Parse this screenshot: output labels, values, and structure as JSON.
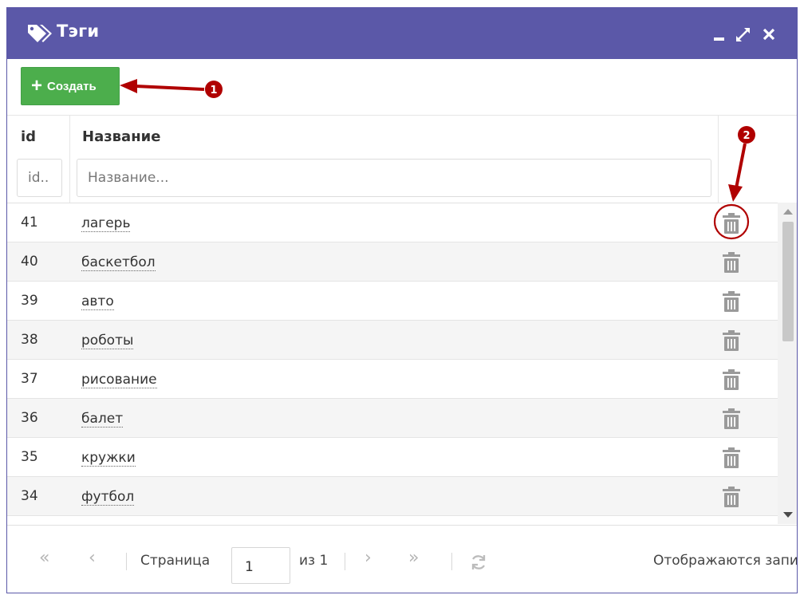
{
  "window": {
    "title": "Тэги",
    "title_icon": "tags-icon",
    "controls": [
      "minimize-icon",
      "maximize-icon",
      "close-icon"
    ],
    "header_color": "#5b58a8"
  },
  "toolbar": {
    "create_label": "Создать",
    "create_color": "#4cae4c"
  },
  "grid": {
    "columns": {
      "id": "id",
      "name": "Название"
    },
    "filters": {
      "id_placeholder": "id..",
      "name_placeholder": "Название..."
    },
    "rows": [
      {
        "id": "41",
        "name": "лагерь"
      },
      {
        "id": "40",
        "name": "баскетбол"
      },
      {
        "id": "39",
        "name": "авто"
      },
      {
        "id": "38",
        "name": "роботы"
      },
      {
        "id": "37",
        "name": "рисование"
      },
      {
        "id": "36",
        "name": "балет"
      },
      {
        "id": "35",
        "name": "кружки"
      },
      {
        "id": "34",
        "name": "футбол"
      }
    ],
    "row_action_icon": "trash-icon"
  },
  "pager": {
    "page_label": "Страница",
    "page_value": "1",
    "of_label": "из 1",
    "info": "Отображаются запи"
  },
  "annotations": {
    "marker_1": "1",
    "marker_2": "2",
    "color": "#b00000"
  }
}
